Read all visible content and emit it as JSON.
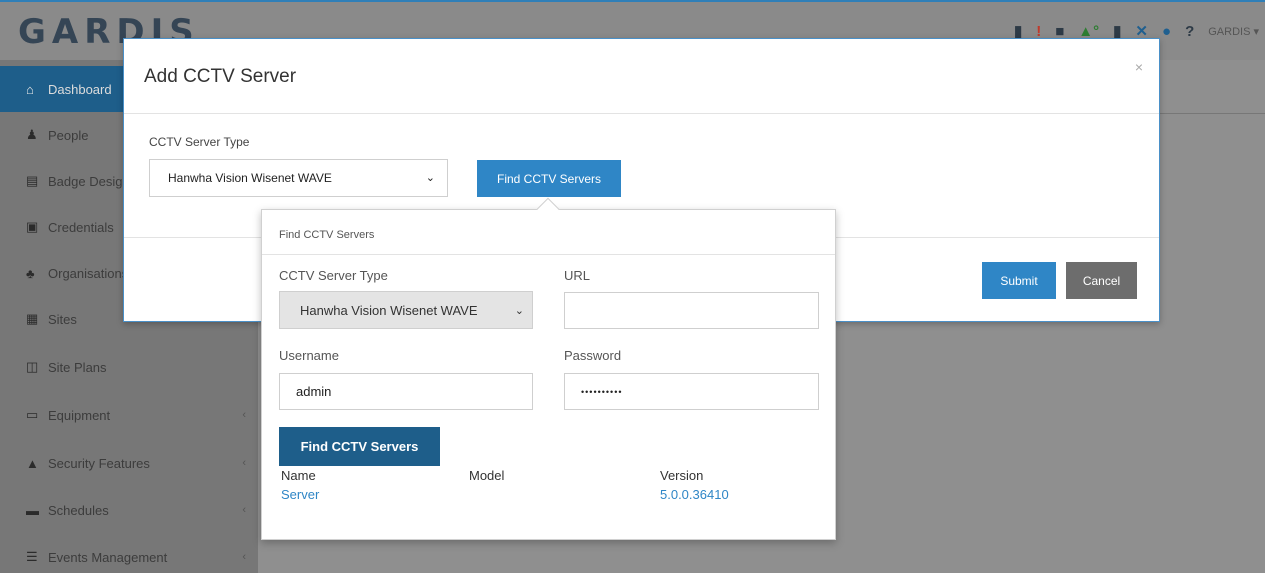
{
  "app": {
    "logo": "GARDIS",
    "user_menu": "GARDIS ▾"
  },
  "topbar_icons": [
    {
      "name": "door-icon",
      "glyph": "▮"
    },
    {
      "name": "alert-icon",
      "glyph": "!"
    },
    {
      "name": "video-camera-icon",
      "glyph": "■"
    },
    {
      "name": "bell-icon",
      "glyph": "▲°"
    },
    {
      "name": "door-open-icon",
      "glyph": "▮"
    },
    {
      "name": "tools-icon",
      "glyph": "✕"
    },
    {
      "name": "info-icon",
      "glyph": "●"
    },
    {
      "name": "help-icon",
      "glyph": "?"
    }
  ],
  "sidebar": {
    "items": [
      {
        "label": "Dashboard",
        "icon": "home-icon",
        "glyph": "⌂"
      },
      {
        "label": "People",
        "icon": "user-icon",
        "glyph": "♟"
      },
      {
        "label": "Badge Designer",
        "icon": "badge-icon",
        "glyph": "▤"
      },
      {
        "label": "Credentials",
        "icon": "credential-icon",
        "glyph": "▣"
      },
      {
        "label": "Organisations",
        "icon": "sitemap-icon",
        "glyph": "♣"
      },
      {
        "label": "Sites",
        "icon": "building-icon",
        "glyph": "▦"
      },
      {
        "label": "Site Plans",
        "icon": "map-icon",
        "glyph": "◫"
      },
      {
        "label": "Equipment",
        "icon": "monitor-icon",
        "glyph": "▭"
      },
      {
        "label": "Security Features",
        "icon": "lock-icon",
        "glyph": "▲"
      },
      {
        "label": "Schedules",
        "icon": "calendar-icon",
        "glyph": "▬"
      },
      {
        "label": "Events Management",
        "icon": "list-icon",
        "glyph": "☰"
      }
    ]
  },
  "modal": {
    "title": "Add CCTV Server",
    "close": "×",
    "server_type_label": "CCTV Server Type",
    "server_type_value": "Hanwha Vision Wisenet WAVE",
    "find_button": "Find CCTV Servers",
    "submit_button": "Submit",
    "cancel_button": "Cancel"
  },
  "popover": {
    "title": "Find CCTV Servers",
    "server_type_label": "CCTV Server Type",
    "server_type_value": "Hanwha Vision Wisenet WAVE",
    "url_label": "URL",
    "url_value": "",
    "username_label": "Username",
    "username_value": "admin",
    "password_label": "Password",
    "password_value": "••••••••••",
    "find_button": "Find CCTV Servers",
    "results": {
      "headers": [
        "Name",
        "Model",
        "Version"
      ],
      "rows": [
        {
          "name": "Server",
          "model": "",
          "version": "5.0.0.36410"
        }
      ]
    }
  },
  "colors": {
    "accent": "#2f86c6",
    "dark_accent": "#1e5e8a",
    "cancel": "#6d6d6d"
  }
}
